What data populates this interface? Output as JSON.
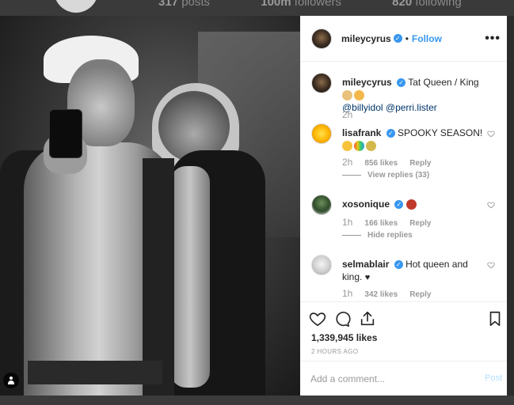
{
  "profile_backdrop": {
    "stats": [
      {
        "count": "317",
        "label": "posts"
      },
      {
        "count": "100m",
        "label": "followers"
      },
      {
        "count": "820",
        "label": "following"
      }
    ]
  },
  "post": {
    "author": "mileycyrus",
    "dot": "•",
    "follow_label": "Follow",
    "more_label": "•••",
    "likes": "1,339,945 likes",
    "time_ago": "2 HOURS AGO"
  },
  "caption": {
    "user": "mileycyrus",
    "text": "Tat Queen / King",
    "mention1": "@billyidol",
    "mention2": "@perri.lister",
    "time": "2h"
  },
  "comments": [
    {
      "user": "lisafrank",
      "text": "SPOOKY SEASON!",
      "time": "2h",
      "likes": "856 likes",
      "reply": "Reply",
      "thread": "View replies (33)"
    },
    {
      "user": "xosonique",
      "text": "",
      "time": "1h",
      "likes": "166 likes",
      "reply": "Reply",
      "thread": "Hide replies"
    },
    {
      "user": "selmablair",
      "text": "Hot queen and king.",
      "time": "1h",
      "likes": "342 likes",
      "reply": "Reply"
    }
  ],
  "comment_box": {
    "placeholder": "Add a comment...",
    "post_label": "Post"
  },
  "colors": {
    "accent": "#3897f0",
    "muted": "#999999",
    "post_disabled": "#b2dffc"
  }
}
